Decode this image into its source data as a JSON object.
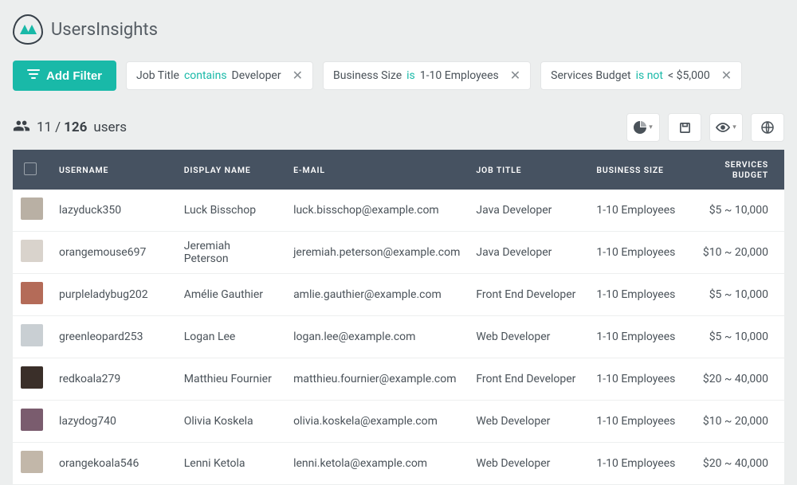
{
  "brand": {
    "name": "UsersInsights"
  },
  "toolbar": {
    "add_filter": "Add Filter",
    "filters": [
      {
        "field": "Job Title",
        "op": "contains",
        "value": "Developer"
      },
      {
        "field": "Business Size",
        "op": "is",
        "value": "1-10 Employees"
      },
      {
        "field": "Services Budget",
        "op": "is not",
        "value": "< $5,000"
      }
    ]
  },
  "count": {
    "shown": "11",
    "sep": "/",
    "total": "126",
    "label": "users"
  },
  "columns": {
    "username": "USERNAME",
    "display_name": "DISPLAY NAME",
    "email": "E-MAIL",
    "job_title": "JOB TITLE",
    "business_size": "BUSINESS SIZE",
    "services_budget": "SERVICES BUDGET"
  },
  "rows": [
    {
      "avatar_color": "#b9b0a4",
      "username": "lazyduck350",
      "display_name": "Luck Bisschop",
      "email": "luck.bisschop@example.com",
      "job_title": "Java Developer",
      "business_size": "1-10 Employees",
      "services_budget": "$5 ~ 10,000"
    },
    {
      "avatar_color": "#d9d3cc",
      "username": "orangemouse697",
      "display_name": "Jeremiah Peterson",
      "email": "jeremiah.peterson@example.com",
      "job_title": "Java Developer",
      "business_size": "1-10 Employees",
      "services_budget": "$10 ~ 20,000"
    },
    {
      "avatar_color": "#b46b58",
      "username": "purpleladybug202",
      "display_name": "Amélie Gauthier",
      "email": "amlie.gauthier@example.com",
      "job_title": "Front End Developer",
      "business_size": "1-10 Employees",
      "services_budget": "$5 ~ 10,000"
    },
    {
      "avatar_color": "#c9cfd3",
      "username": "greenleopard253",
      "display_name": "Logan Lee",
      "email": "logan.lee@example.com",
      "job_title": "Web Developer",
      "business_size": "1-10 Employees",
      "services_budget": "$5 ~ 10,000"
    },
    {
      "avatar_color": "#3a2f29",
      "username": "redkoala279",
      "display_name": "Matthieu Fournier",
      "email": "matthieu.fournier@example.com",
      "job_title": "Front End Developer",
      "business_size": "1-10 Employees",
      "services_budget": "$20 ~ 40,000"
    },
    {
      "avatar_color": "#7a5c6e",
      "username": "lazydog740",
      "display_name": "Olivia Koskela",
      "email": "olivia.koskela@example.com",
      "job_title": "Web Developer",
      "business_size": "1-10 Employees",
      "services_budget": "$10 ~ 20,000"
    },
    {
      "avatar_color": "#c2b7a9",
      "username": "orangekoala546",
      "display_name": "Lenni Ketola",
      "email": "lenni.ketola@example.com",
      "job_title": "Web Developer",
      "business_size": "1-10 Employees",
      "services_budget": "$20 ~ 40,000"
    }
  ]
}
